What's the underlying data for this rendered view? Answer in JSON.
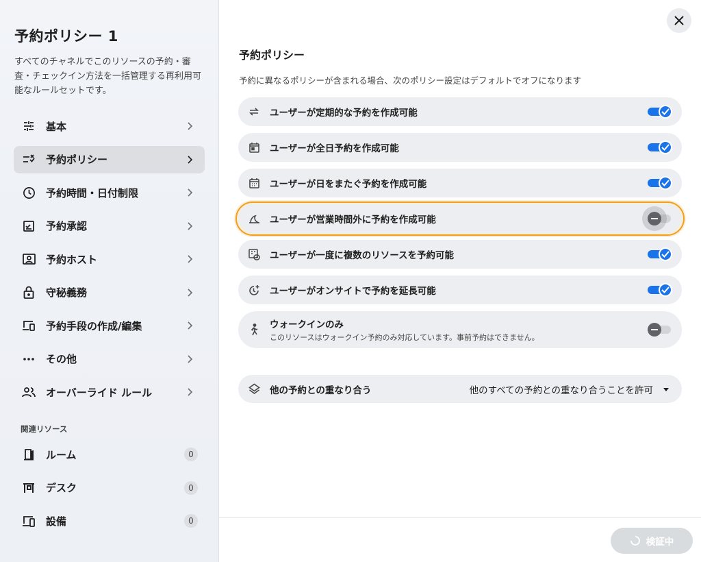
{
  "sidebar": {
    "title": "予約ポリシー 1",
    "description": "すべてのチャネルでこのリソースの予約・審査・チェックイン方法を一括管理する再利用可能なルールセットです。",
    "items": [
      {
        "label": "基本",
        "icon": "tune-icon"
      },
      {
        "label": "予約ポリシー",
        "icon": "checklist-icon"
      },
      {
        "label": "予約時間・日付制限",
        "icon": "clock-icon"
      },
      {
        "label": "予約承認",
        "icon": "approval-icon"
      },
      {
        "label": "予約ホスト",
        "icon": "host-icon"
      },
      {
        "label": "守秘義務",
        "icon": "lock-icon"
      },
      {
        "label": "予約手段の作成/編集",
        "icon": "devices-icon"
      },
      {
        "label": "その他",
        "icon": "more-icon"
      },
      {
        "label": "オーバーライド ルール",
        "icon": "group-icon"
      }
    ],
    "related_label": "関連リソース",
    "resources": [
      {
        "label": "ルーム",
        "count": "0",
        "icon": "door-icon"
      },
      {
        "label": "デスク",
        "count": "0",
        "icon": "desk-icon"
      },
      {
        "label": "設備",
        "count": "0",
        "icon": "equipment-icon"
      }
    ]
  },
  "main": {
    "title": "予約ポリシー",
    "subtitle": "予約に異なるポリシーが含まれる場合、次のポリシー設定はデフォルトでオフになります",
    "policies": [
      {
        "label": "ユーザーが定期的な予約を作成可能",
        "icon": "repeat-icon",
        "enabled": true
      },
      {
        "label": "ユーザーが全日予約を作成可能",
        "icon": "calendar-day-icon",
        "enabled": true
      },
      {
        "label": "ユーザーが日をまたぐ予約を作成可能",
        "icon": "calendar-icon",
        "enabled": true
      },
      {
        "label": "ユーザーが営業時間外に予約を作成可能",
        "icon": "moon-icon",
        "enabled": false
      },
      {
        "label": "ユーザーが一度に複数のリソースを予約可能",
        "icon": "multi-resource-icon",
        "enabled": true
      },
      {
        "label": "ユーザーがオンサイトで予約を延長可能",
        "icon": "clock-plus-icon",
        "enabled": true
      }
    ],
    "walkin": {
      "label": "ウォークインのみ",
      "description": "このリソースはウォークイン予約のみ対応しています。事前予約はできません。",
      "enabled": false
    },
    "overlap": {
      "label": "他の予約との重なり合う",
      "value": "他のすべての予約との重なり合うことを許可"
    },
    "verify_label": "検証中"
  },
  "colors": {
    "accent": "#1a73e8",
    "focus": "#f0a020"
  }
}
